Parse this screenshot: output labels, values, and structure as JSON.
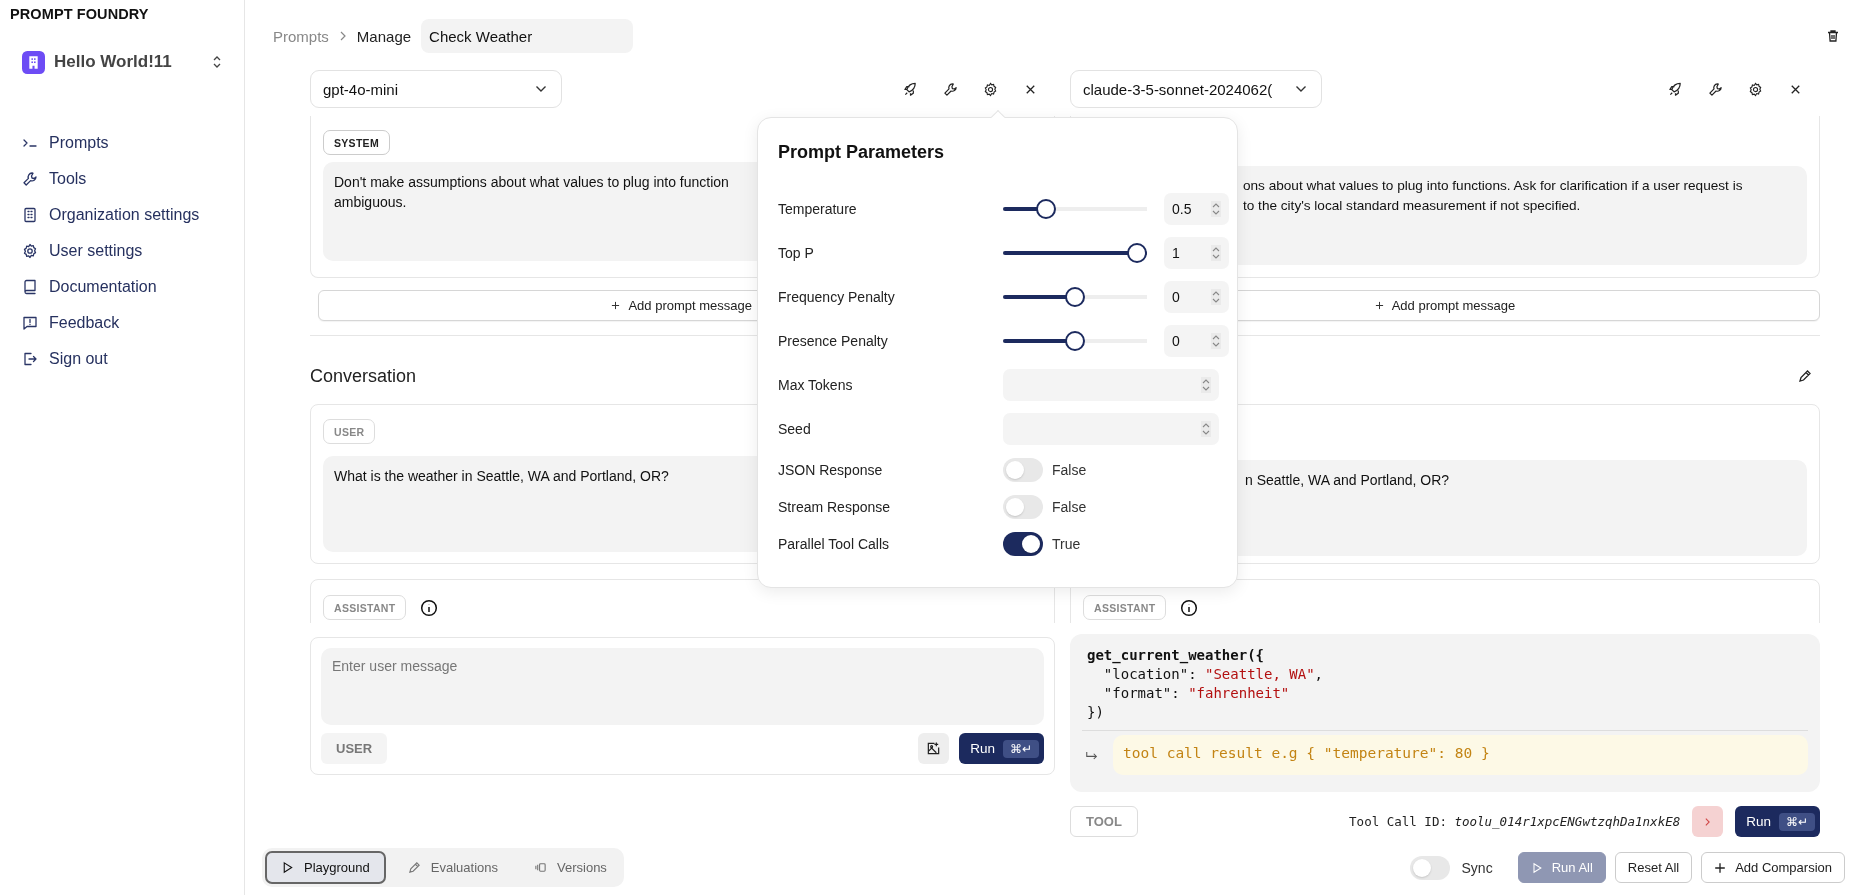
{
  "sidebar": {
    "brand": "PROMPT FOUNDRY",
    "workspace": "Hello World!11",
    "items": [
      {
        "label": "Prompts",
        "kind": "prompt"
      },
      {
        "label": "Tools",
        "kind": "wrench"
      },
      {
        "label": "Organization settings",
        "kind": "building"
      },
      {
        "label": "User settings",
        "kind": "gear"
      },
      {
        "label": "Documentation",
        "kind": "book"
      },
      {
        "label": "Feedback",
        "kind": "feedback"
      },
      {
        "label": "Sign out",
        "kind": "signout"
      }
    ]
  },
  "breadcrumb": {
    "items": [
      "Prompts",
      "Manage"
    ],
    "title": "Check Weather"
  },
  "columns": [
    {
      "model": "gpt-4o-mini",
      "system_role": "SYSTEM",
      "system_lines": [
        "Don't make assumptions about what values to plug into function",
        "ambiguous."
      ],
      "add_message": "Add prompt message",
      "user_role": "USER",
      "user_message": "What is the weather in Seattle, WA and Portland, OR?",
      "assistant_role": "ASSISTANT"
    },
    {
      "model": "claude-3-5-sonnet-2024062(",
      "system_lines": [
        "ons about what values to plug into functions. Ask for clarification if a user request is",
        "to the city's local standard measurement if not specified."
      ],
      "add_message": "Add prompt message",
      "user_message": "n Seattle, WA and Portland, OR?",
      "assistant_role": "ASSISTANT"
    }
  ],
  "conversation": {
    "title": "Conversation"
  },
  "composer": {
    "placeholder": "Enter user message",
    "role": "USER",
    "run": "Run",
    "shortcut": "⌘↵"
  },
  "tool_call": {
    "lines": [
      [
        {
          "text": "get_current_weather({",
          "kind": "fn"
        }
      ],
      [
        {
          "text": "  \"location\": ",
          "kind": "plain"
        },
        {
          "text": "\"Seattle, WA\"",
          "kind": "string"
        },
        {
          "text": ",",
          "kind": "plain"
        }
      ],
      [
        {
          "text": "  \"format\": ",
          "kind": "plain"
        },
        {
          "text": "\"fahrenheit\"",
          "kind": "string"
        }
      ],
      [
        {
          "text": "})",
          "kind": "plain"
        }
      ]
    ],
    "result_placeholder": "tool call result e.g { \"temperature\": 80 }",
    "role": "TOOL",
    "id_label": "Tool Call ID:",
    "id_value": "toolu_014r1xpcENGwtzqhDa1nxkE8",
    "run": "Run",
    "shortcut": "⌘↵"
  },
  "parameters": {
    "title": "Prompt Parameters",
    "items": [
      {
        "kind": "slider",
        "label": "Temperature",
        "level": 0.27,
        "value": "0.5"
      },
      {
        "kind": "slider",
        "label": "Top P",
        "level": 1,
        "value": "1"
      },
      {
        "kind": "slider",
        "label": "Frequency Penalty",
        "level": 0.5,
        "value": "0"
      },
      {
        "kind": "slider",
        "label": "Presence Penalty",
        "level": 0.5,
        "value": "0"
      },
      {
        "kind": "number",
        "label": "Max Tokens"
      },
      {
        "kind": "number",
        "label": "Seed"
      },
      {
        "kind": "toggle",
        "label": "JSON Response",
        "on": false,
        "value": "False"
      },
      {
        "kind": "toggle",
        "label": "Stream Response",
        "on": false,
        "value": "False"
      },
      {
        "kind": "toggle",
        "label": "Parallel Tool Calls",
        "on": true,
        "value": "True"
      }
    ]
  },
  "bottom_tabs": [
    {
      "label": "Playground",
      "selected": true,
      "kind": "play"
    },
    {
      "label": "Evaluations",
      "selected": false,
      "kind": "pencil"
    },
    {
      "label": "Versions",
      "selected": false,
      "kind": "versions"
    }
  ],
  "sync": {
    "label": "Sync",
    "on": false
  },
  "actions": [
    {
      "label": "Run All",
      "kind": "run",
      "disabled": true
    },
    {
      "label": "Reset All",
      "kind": "plain",
      "disabled": false
    },
    {
      "label": "Add Comparsion",
      "kind": "add",
      "disabled": false
    }
  ]
}
